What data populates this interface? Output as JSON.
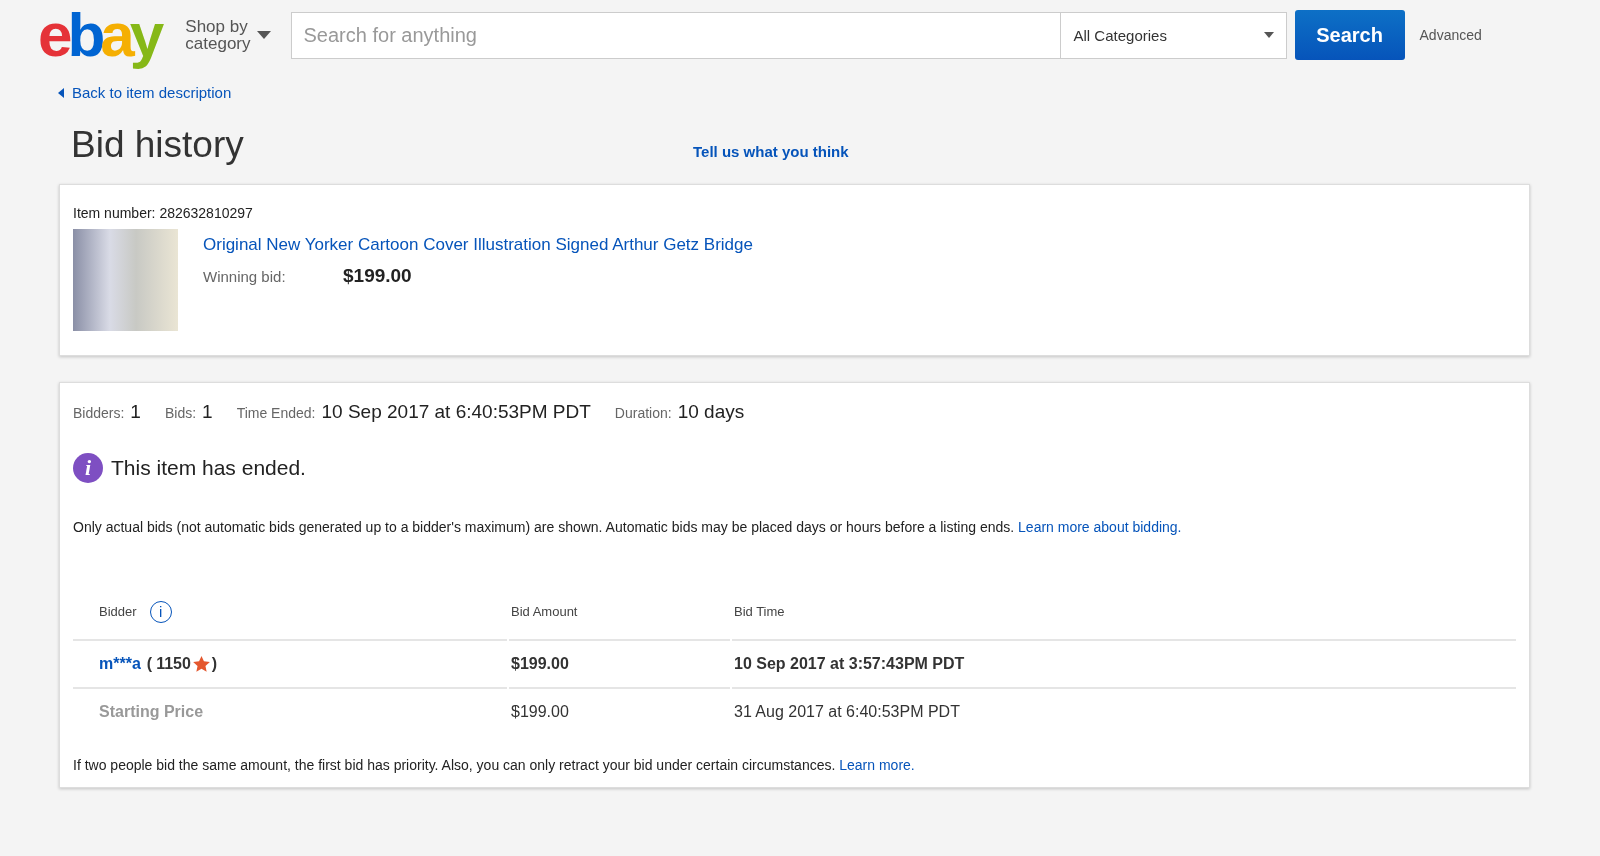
{
  "header": {
    "logo": "ebay",
    "shop_by_category": [
      "Shop by",
      "category"
    ],
    "search": {
      "placeholder": "Search for anything"
    },
    "category_select": "All Categories",
    "search_button": "Search",
    "advanced_link": "Advanced"
  },
  "back_link": "Back to item description",
  "page_title": "Bid history",
  "feedback_link": "Tell us what you think",
  "item": {
    "number_label": "Item number:",
    "number": "282632810297",
    "title": "Original New Yorker Cartoon Cover Illustration Signed Arthur Getz Bridge",
    "winning_bid_label": "Winning bid:",
    "winning_bid": "$199.00"
  },
  "summary": [
    {
      "label": "Bidders:",
      "value": "1"
    },
    {
      "label": "Bids:",
      "value": "1"
    },
    {
      "label": "Time Ended:",
      "value": "10 Sep 2017 at 6:40:53PM PDT"
    },
    {
      "label": "Duration:",
      "value": "10 days"
    }
  ],
  "notice": {
    "icon": "i",
    "text": "This item has ended."
  },
  "explanation": {
    "text": "Only actual bids (not automatic bids generated up to a bidder's maximum) are shown. Automatic bids may be placed days or hours before a listing ends.",
    "link": "Learn more about bidding."
  },
  "table": {
    "columns": [
      "Bidder",
      "Bid Amount",
      "Bid Time"
    ],
    "info_icon": "i",
    "rows": [
      {
        "kind": "bid",
        "bidder": "m***a",
        "score_open": "(",
        "feedback_score": "1150",
        "score_close": ")",
        "amount": "$199.00",
        "time": "10 Sep 2017 at 3:57:43PM PDT"
      },
      {
        "kind": "starting",
        "bidder": "Starting Price",
        "amount": "$199.00",
        "time": "31 Aug 2017 at 6:40:53PM PDT"
      }
    ]
  },
  "footer_note": {
    "text": "If two people bid the same amount, the first bid has priority. Also, you can only retract your bid under certain circumstances.",
    "link": "Learn more."
  }
}
